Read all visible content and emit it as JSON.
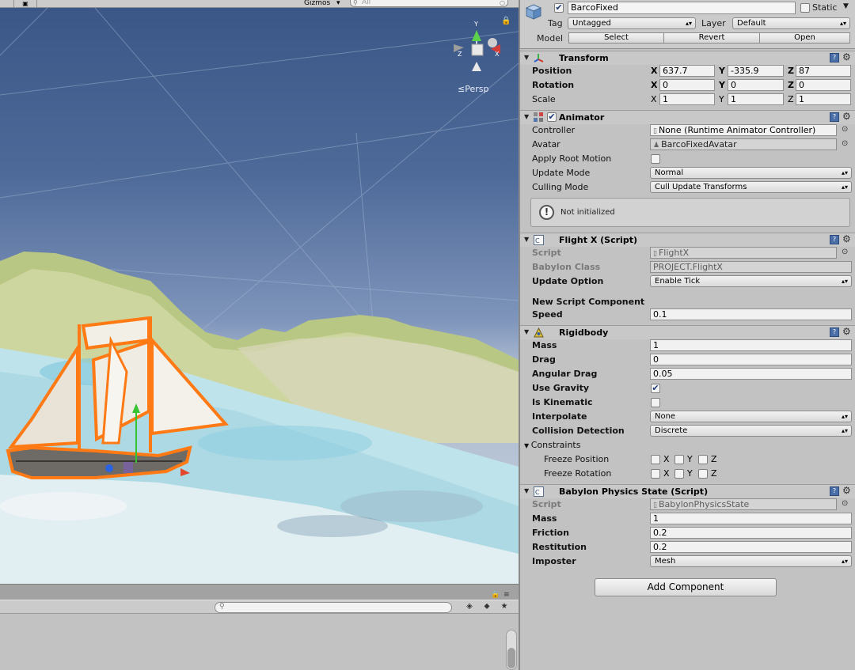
{
  "scene": {
    "gizmos_label": "Gizmos",
    "search_placeholder": "All",
    "persp_label": "Persp"
  },
  "inspector": {
    "object_name": "BarcoFixed",
    "static_label": "Static",
    "tag_label": "Tag",
    "tag_value": "Untagged",
    "layer_label": "Layer",
    "layer_value": "Default",
    "model_label": "Model",
    "model_buttons": [
      "Select",
      "Revert",
      "Open"
    ],
    "transform": {
      "title": "Transform",
      "position_label": "Position",
      "rotation_label": "Rotation",
      "scale_label": "Scale",
      "position": {
        "x": "637.7",
        "y": "-335.9",
        "z": "87"
      },
      "rotation": {
        "x": "0",
        "y": "0",
        "z": "0"
      },
      "scale": {
        "x": "1",
        "y": "1",
        "z": "1"
      }
    },
    "animator": {
      "title": "Animator",
      "controller_label": "Controller",
      "controller_value": "None (Runtime Animator Controller)",
      "avatar_label": "Avatar",
      "avatar_value": "BarcoFixedAvatar",
      "apply_root_motion_label": "Apply Root Motion",
      "update_mode_label": "Update Mode",
      "update_mode_value": "Normal",
      "culling_mode_label": "Culling Mode",
      "culling_mode_value": "Cull Update Transforms",
      "status_message": "Not initialized"
    },
    "flightx": {
      "title": "Flight X (Script)",
      "script_label": "Script",
      "script_value": "FlightX",
      "babylon_class_label": "Babylon Class",
      "babylon_class_value": "PROJECT.FlightX",
      "update_option_label": "Update Option",
      "update_option_value": "Enable Tick",
      "new_script_label": "New Script Component",
      "speed_label": "Speed",
      "speed_value": "0.1"
    },
    "rigidbody": {
      "title": "Rigidbody",
      "mass_label": "Mass",
      "mass_value": "1",
      "drag_label": "Drag",
      "drag_value": "0",
      "angular_drag_label": "Angular Drag",
      "angular_drag_value": "0.05",
      "use_gravity_label": "Use Gravity",
      "use_gravity": true,
      "is_kinematic_label": "Is Kinematic",
      "is_kinematic": false,
      "interpolate_label": "Interpolate",
      "interpolate_value": "None",
      "collision_label": "Collision Detection",
      "collision_value": "Discrete",
      "constraints_label": "Constraints",
      "freeze_position_label": "Freeze Position",
      "freeze_rotation_label": "Freeze Rotation",
      "axis_x": "X",
      "axis_y": "Y",
      "axis_z": "Z"
    },
    "physics_state": {
      "title": "Babylon Physics State (Script)",
      "script_label": "Script",
      "script_value": "BabylonPhysicsState",
      "mass_label": "Mass",
      "mass_value": "1",
      "friction_label": "Friction",
      "friction_value": "0.2",
      "restitution_label": "Restitution",
      "restitution_value": "0.2",
      "imposter_label": "Imposter",
      "imposter_value": "Mesh"
    },
    "add_component_label": "Add Component"
  },
  "axis_letters": {
    "x": "X",
    "y": "Y",
    "z": "Z"
  },
  "colors": {
    "sky_top": "#3a5686",
    "selection_orange": "#ff7a14",
    "panel_grey": "#c2c2c2",
    "help_blue": "#4a6fa8"
  }
}
